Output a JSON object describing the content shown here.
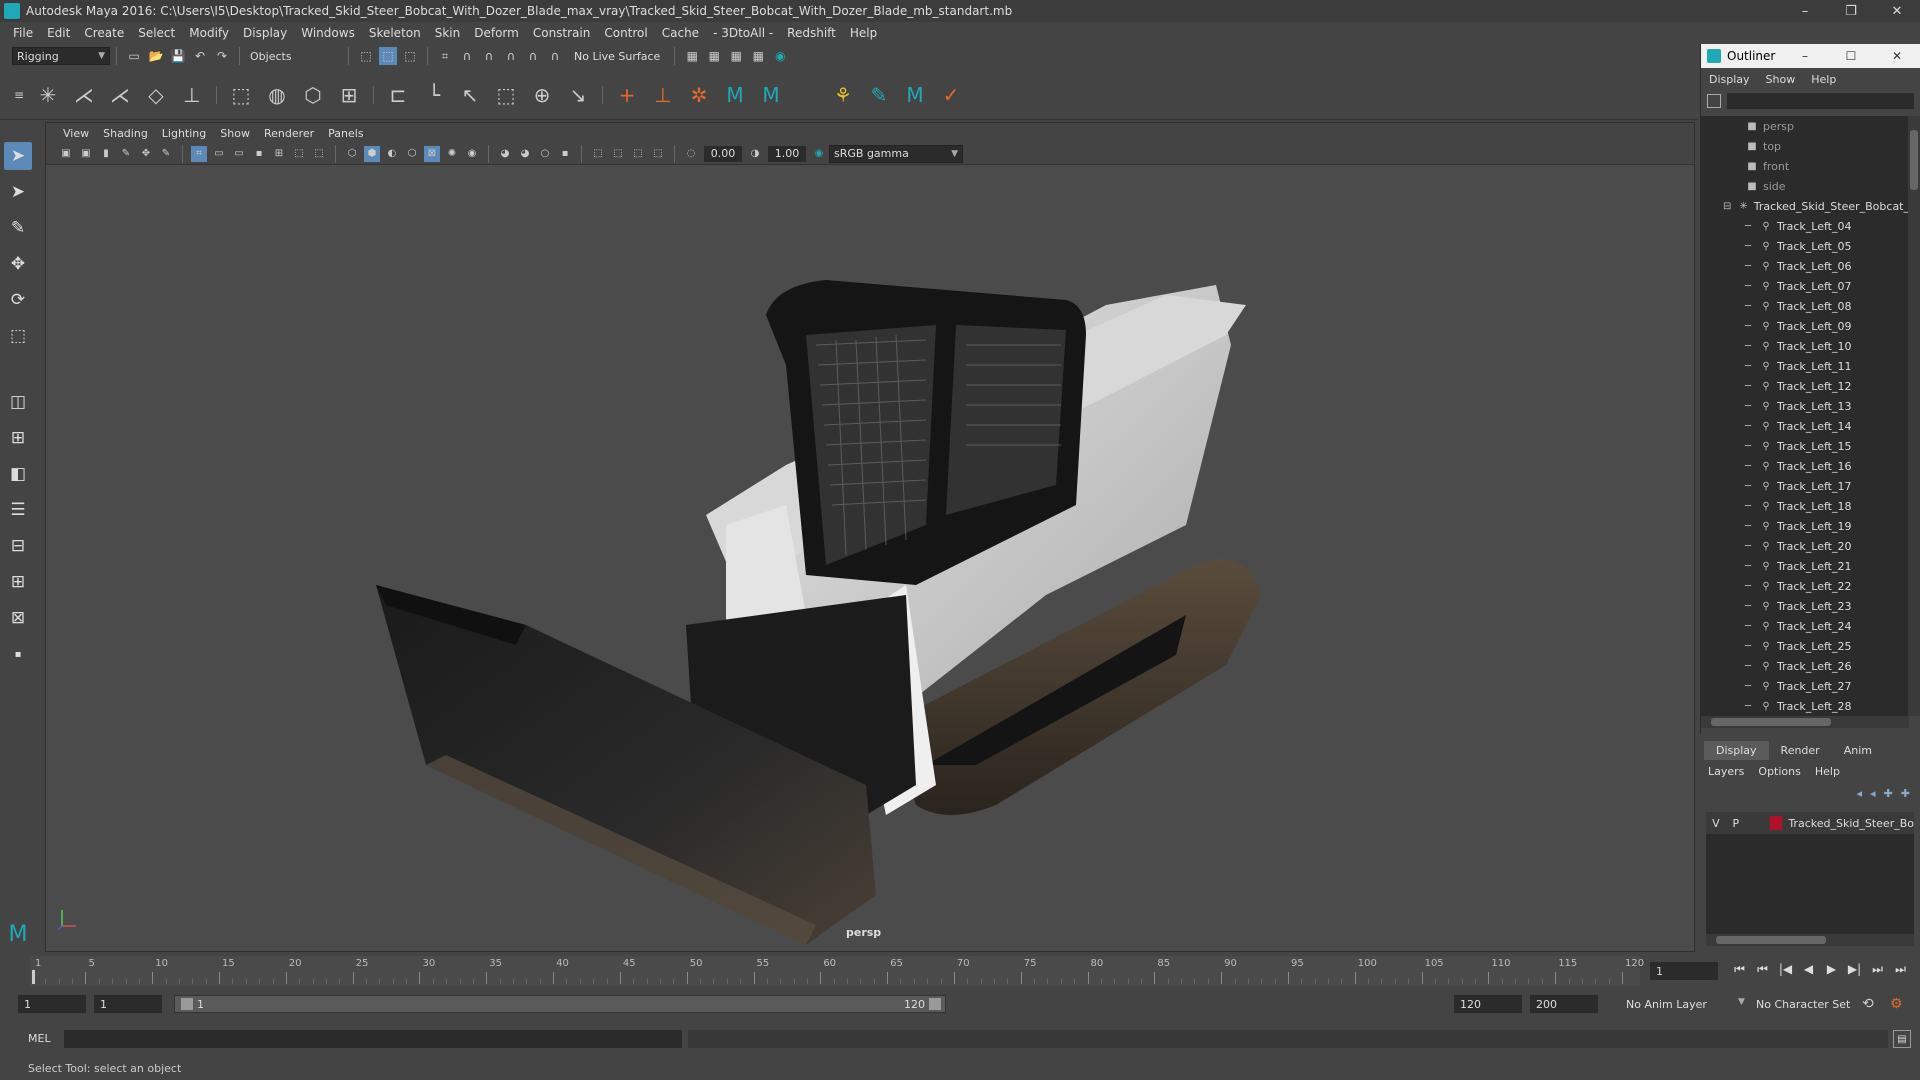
{
  "window": {
    "title": "Autodesk Maya 2016: C:\\Users\\I5\\Desktop\\Tracked_Skid_Steer_Bobcat_With_Dozer_Blade_max_vray\\Tracked_Skid_Steer_Bobcat_With_Dozer_Blade_mb_standart.mb",
    "minimize": "–",
    "restore": "❐",
    "close": "✕"
  },
  "menubar": [
    "File",
    "Edit",
    "Create",
    "Select",
    "Modify",
    "Display",
    "Windows",
    "Skeleton",
    "Skin",
    "Deform",
    "Constrain",
    "Control",
    "Cache",
    "- 3DtoAll -",
    "Redshift",
    "Help"
  ],
  "statusline": {
    "menuset": "Rigging",
    "selection_mode": "Objects",
    "live_surface": "No Live Surface"
  },
  "viewport": {
    "menu": [
      "View",
      "Shading",
      "Lighting",
      "Show",
      "Renderer",
      "Panels"
    ],
    "exposure": "0.00",
    "gamma": "1.00",
    "color_space": "sRGB gamma",
    "camera_label": "persp"
  },
  "outliner": {
    "title": "Outliner",
    "menu": [
      "Display",
      "Show",
      "Help"
    ],
    "cameras": [
      "persp",
      "top",
      "front",
      "side"
    ],
    "root": "Tracked_Skid_Steer_Bobcat_",
    "children": [
      "Track_Left_04",
      "Track_Left_05",
      "Track_Left_06",
      "Track_Left_07",
      "Track_Left_08",
      "Track_Left_09",
      "Track_Left_10",
      "Track_Left_11",
      "Track_Left_12",
      "Track_Left_13",
      "Track_Left_14",
      "Track_Left_15",
      "Track_Left_16",
      "Track_Left_17",
      "Track_Left_18",
      "Track_Left_19",
      "Track_Left_20",
      "Track_Left_21",
      "Track_Left_22",
      "Track_Left_23",
      "Track_Left_24",
      "Track_Left_25",
      "Track_Left_26",
      "Track_Left_27",
      "Track_Left_28"
    ]
  },
  "layer_editor": {
    "tabs": [
      "Display",
      "Render",
      "Anim"
    ],
    "menu": [
      "Layers",
      "Options",
      "Help"
    ],
    "layer": {
      "visible": "V",
      "playback": "P",
      "name": "Tracked_Skid_Steer_Bo",
      "color": "#b0102a"
    }
  },
  "timeslider": {
    "ticks": [
      1,
      5,
      10,
      15,
      20,
      25,
      30,
      35,
      40,
      45,
      50,
      55,
      60,
      65,
      70,
      75,
      80,
      85,
      90,
      95,
      100,
      105,
      110,
      115,
      120
    ],
    "current_frame": "1",
    "playback_buttons": [
      "⏮",
      "⏮",
      "|◀",
      "◀",
      "▶",
      "▶|",
      "⏭",
      "⏭"
    ]
  },
  "rangeslider": {
    "start_time": "1",
    "playback_start": "1",
    "range_start": "1",
    "range_end": "120",
    "playback_end": "120",
    "end_time": "200",
    "anim_layer": "No Anim Layer",
    "character_set": "No Character Set"
  },
  "commandline": {
    "label": "MEL"
  },
  "helpline": {
    "text": "Select Tool: select an object"
  }
}
